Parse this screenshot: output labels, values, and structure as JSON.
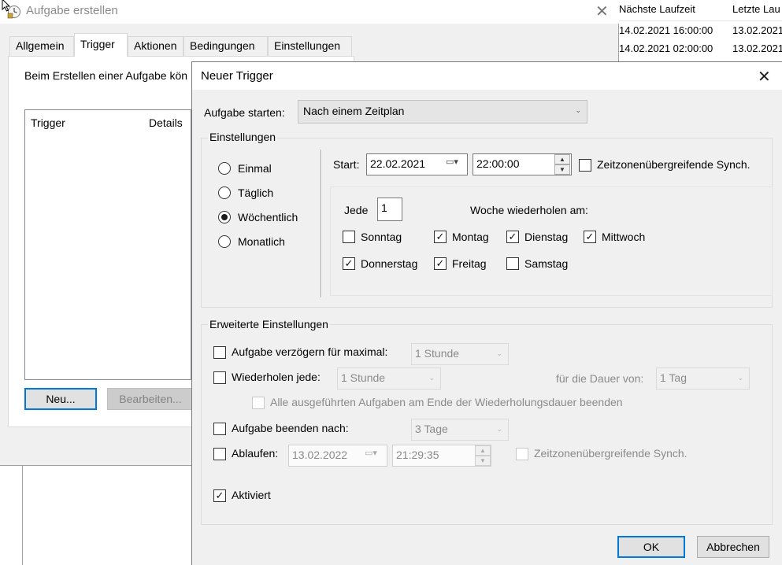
{
  "background_table": {
    "col_next_run": "Nächste Laufzeit",
    "col_last_run": "Letzte Lau",
    "rows": [
      {
        "next": "14.02.2021 16:00:00",
        "last": "13.02.2021"
      },
      {
        "next": "14.02.2021 02:00:00",
        "last": "13.02.2021"
      }
    ]
  },
  "parent_dialog": {
    "title": "Aufgabe erstellen",
    "close": "✕",
    "tabs": [
      "Allgemein",
      "Trigger",
      "Aktionen",
      "Bedingungen",
      "Einstellungen"
    ],
    "description": "Beim Erstellen einer Aufgabe kön",
    "list_columns": [
      "Trigger",
      "Details"
    ],
    "btn_new": "Neu...",
    "btn_edit": "Bearbeiten..."
  },
  "dialog": {
    "title": "Neuer Trigger",
    "close": "✕",
    "start_task_label": "Aufgabe starten:",
    "start_task_value": "Nach einem Zeitplan",
    "settings_group": "Einstellungen",
    "schedule_options": [
      "Einmal",
      "Täglich",
      "Wöchentlich",
      "Monatlich"
    ],
    "selected_schedule": "Wöchentlich",
    "start_label": "Start:",
    "start_date": "22.02.2021",
    "start_time": "22:00:00",
    "tz_sync": "Zeitzonenübergreifende Synch.",
    "every_label": "Jede",
    "every_value": "1",
    "repeat_week_label": "Woche wiederholen am:",
    "days": [
      {
        "label": "Sonntag",
        "checked": false
      },
      {
        "label": "Montag",
        "checked": true
      },
      {
        "label": "Dienstag",
        "checked": true
      },
      {
        "label": "Mittwoch",
        "checked": true
      },
      {
        "label": "Donnerstag",
        "checked": true
      },
      {
        "label": "Freitag",
        "checked": true
      },
      {
        "label": "Samstag",
        "checked": false
      }
    ],
    "advanced_group": "Erweiterte Einstellungen",
    "delay_label": "Aufgabe verzögern für maximal:",
    "delay_value": "1 Stunde",
    "repeat_label": "Wiederholen jede:",
    "repeat_value": "1 Stunde",
    "duration_label": "für die Dauer von:",
    "duration_value": "1 Tag",
    "stop_all_label": "Alle ausgeführten Aufgaben am Ende der Wiederholungsdauer beenden",
    "stop_after_label": "Aufgabe beenden nach:",
    "stop_after_value": "3 Tage",
    "expire_label": "Ablaufen:",
    "expire_date": "13.02.2022",
    "expire_time": "21:29:35",
    "expire_tz_sync": "Zeitzonenübergreifende Synch.",
    "enabled_label": "Aktiviert",
    "enabled_checked": true,
    "ok": "OK",
    "cancel": "Abbrechen"
  }
}
